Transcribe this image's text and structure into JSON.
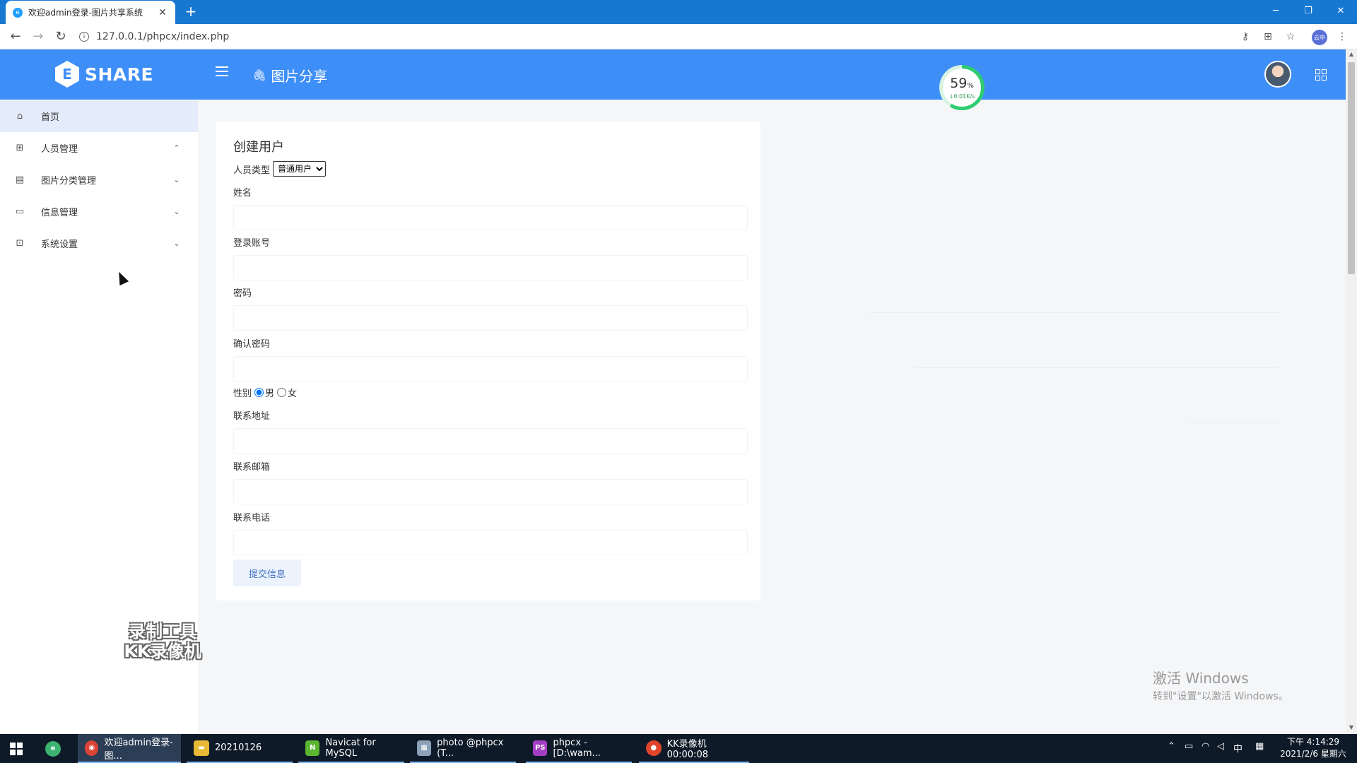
{
  "browser": {
    "tab_title": "欢迎admin登录-图片共享系统",
    "tab_close": "✕",
    "new_tab": "+",
    "url": "127.0.0.1/phpcx/index.php",
    "profile_label": "云中"
  },
  "header": {
    "logo_mark": "E",
    "logo_text": "SHARE",
    "title": "图片分享",
    "speed_percent": "59",
    "speed_percent_unit": "%",
    "speed_rate": "↓0.01K/s",
    "speed_fraction": 0.59
  },
  "sidebar": {
    "items": [
      {
        "label": "首页",
        "icon": "home-icon",
        "active": true
      },
      {
        "label": "人员管理",
        "icon": "grid-icon",
        "chevron": "up"
      },
      {
        "label": "图片分类管理",
        "icon": "doc-icon",
        "chevron": "down"
      },
      {
        "label": "信息管理",
        "icon": "file-icon",
        "chevron": "down"
      },
      {
        "label": "系统设置",
        "icon": "terminal-icon",
        "chevron": "down"
      }
    ]
  },
  "watermark": {
    "line1": "录制工具",
    "line2": "KK录像机"
  },
  "form": {
    "title": "创建用户",
    "type_label": "人员类型",
    "type_selected": "普通用户",
    "name_label": "姓名",
    "account_label": "登录账号",
    "password_label": "密码",
    "confirm_label": "确认密码",
    "gender_label": "性别",
    "gender_male": "男",
    "gender_female": "女",
    "address_label": "联系地址",
    "email_label": "联系邮箱",
    "phone_label": "联系电话",
    "submit_label": "提交信息"
  },
  "activation": {
    "line1": "激活 Windows",
    "line2": "转到\"设置\"以激活 Windows。"
  },
  "taskbar": {
    "items": [
      {
        "label": "欢迎admin登录-图...",
        "icon": "chrome-icon"
      },
      {
        "label": "20210126",
        "icon": "folder-icon"
      },
      {
        "label": "Navicat for MySQL",
        "icon": "navicat-icon"
      },
      {
        "label": "photo @phpcx (T...",
        "icon": "table-icon"
      },
      {
        "label": "phpcx - [D:\\wam...",
        "icon": "phpstorm-icon"
      },
      {
        "label": "KK录像机 00:00:08",
        "icon": "kk-icon"
      }
    ],
    "ime": "中",
    "time": "下午 4:14:29",
    "date": "2021/2/6 星期六"
  },
  "colors": {
    "header": "#3e8ef7",
    "active_menu": "#e4ecfb",
    "browser_bar": "#1778d2",
    "taskbar": "#0e1a28"
  }
}
